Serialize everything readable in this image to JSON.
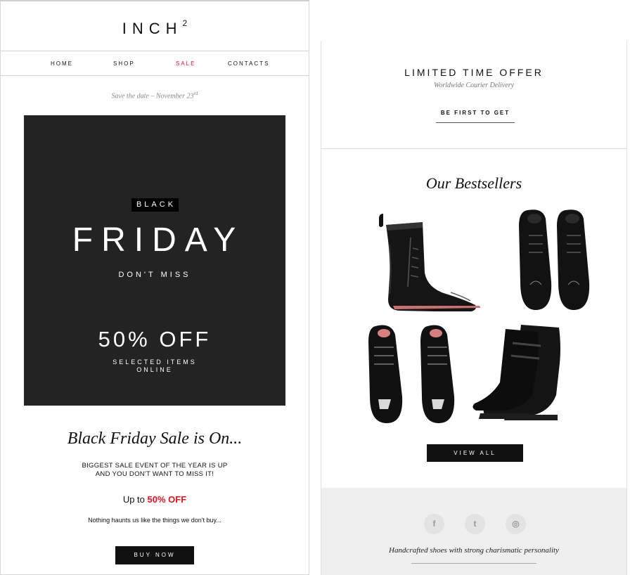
{
  "left_email": {
    "logo": {
      "text": "INCH",
      "superscript": "2"
    },
    "nav": [
      {
        "label": "HOME",
        "color": "#111111"
      },
      {
        "label": "SHOP",
        "color": "#111111"
      },
      {
        "label": "SALE",
        "color": "#e8121f"
      },
      {
        "label": "CONTACTS",
        "color": "#111111"
      }
    ],
    "save_date": {
      "text": "Save the date – November 23",
      "superscript": "rd"
    },
    "hero": {
      "tag": "BLACK",
      "title": "FRIDAY",
      "subtitle": "DON'T MISS",
      "discount": "50% OFF",
      "items_line1": "SELECTED ITEMS",
      "items_line2": "ONLINE",
      "background": "#232323"
    },
    "sale_heading": "Black Friday Sale is On...",
    "sale_line1": "BIGGEST SALE EVENT OF THE YEAR IS UP",
    "sale_line2": "AND YOU DON'T WANT TO MISS IT!",
    "upto_prefix": "Up to",
    "upto_value": "50% OFF",
    "haunts": "Nothing haunts us like the things we don't buy...",
    "buy_button": "BUY NOW"
  },
  "right_email": {
    "offer_title": "LIMITED TIME OFFER",
    "offer_sub": "Worldwide Courier Delivery",
    "first_button": "BE FIRST TO GET",
    "bestsellers_heading": "Our Bestsellers",
    "products": [
      {
        "icon": "tall-lace-up-boot-icon"
      },
      {
        "icon": "derby-shoes-pair-icon"
      },
      {
        "icon": "metal-toe-shoes-pair-icon"
      },
      {
        "icon": "buckle-boot-pair-icon"
      }
    ],
    "view_all_button": "VIEW ALL",
    "social": [
      {
        "icon": "facebook-icon",
        "glyph": "f"
      },
      {
        "icon": "twitter-icon",
        "glyph": "t"
      },
      {
        "icon": "instagram-icon",
        "glyph": "◎"
      }
    ],
    "footer_tagline": "Handcrafted shoes with strong charismatic personality"
  }
}
